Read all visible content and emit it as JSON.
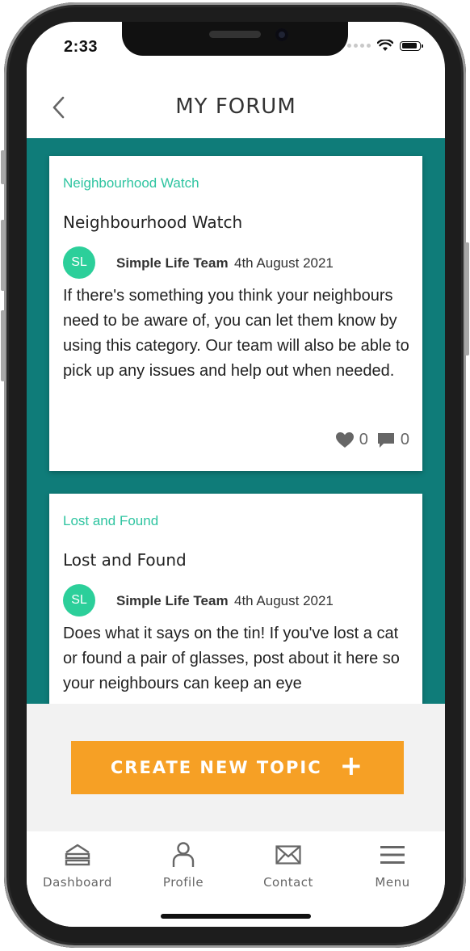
{
  "status": {
    "time": "2:33"
  },
  "header": {
    "title": "MY FORUM"
  },
  "posts": [
    {
      "category": "Neighbourhood Watch",
      "title": "Neighbourhood Watch",
      "avatar": "SL",
      "author": "Simple Life Team",
      "date": "4th August 2021",
      "body": "If there's something you think your neighbours need to be aware of, you can let them know by using this category. Our team will also be able to pick up any issues and help out when needed.",
      "likes": "0",
      "comments": "0"
    },
    {
      "category": "Lost and Found",
      "title": "Lost and Found",
      "avatar": "SL",
      "author": "Simple Life Team",
      "date": "4th August 2021",
      "body": "Does what it says on the tin! If you've lost a cat or found a pair of glasses, post about it here so your neighbours can keep an eye"
    }
  ],
  "actions": {
    "create_topic": "CREATE NEW TOPIC",
    "create_icon": "+"
  },
  "tabs": [
    {
      "label": "Dashboard",
      "icon": "dashboard-icon"
    },
    {
      "label": "Profile",
      "icon": "profile-icon"
    },
    {
      "label": "Contact",
      "icon": "envelope-icon"
    },
    {
      "label": "Menu",
      "icon": "hamburger-menu-icon"
    }
  ],
  "colors": {
    "teal": "#0f7c79",
    "accent_green": "#2ec4a0",
    "orange": "#f6a025"
  }
}
